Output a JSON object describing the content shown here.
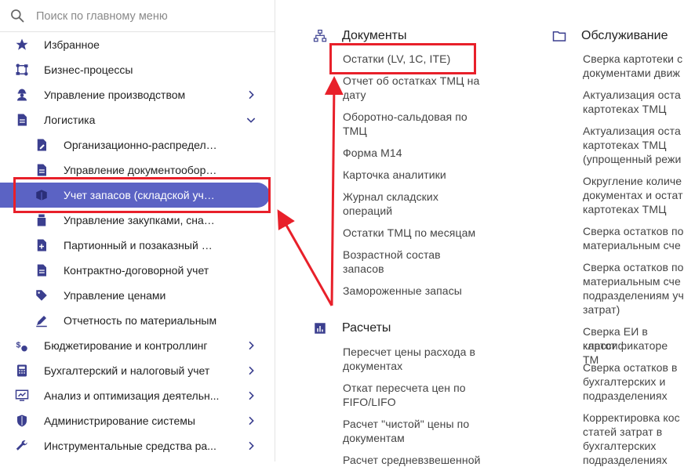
{
  "search": {
    "placeholder": "Поиск по главному меню"
  },
  "sidebar": {
    "items": [
      {
        "label": "Избранное"
      },
      {
        "label": "Бизнес-процессы"
      },
      {
        "label": "Управление производством"
      },
      {
        "label": "Логистика"
      },
      {
        "label": "Организационно-распределительн"
      },
      {
        "label": "Управление документооборотом"
      },
      {
        "label": "Учет запасов (складской учет)"
      },
      {
        "label": "Управление закупками, снабжением"
      },
      {
        "label": "Партионный и позаказный учет"
      },
      {
        "label": "Контрактно-договорной учет"
      },
      {
        "label": "Управление ценами"
      },
      {
        "label": "Отчетность по материальным"
      },
      {
        "label": "Бюджетирование и контроллинг"
      },
      {
        "label": "Бухгалтерский и налоговый учет"
      },
      {
        "label": "Анализ и оптимизация деятельн..."
      },
      {
        "label": "Администрирование системы"
      },
      {
        "label": "Инструментальные средства ра..."
      }
    ]
  },
  "main": {
    "documents": {
      "title": "Документы",
      "links": [
        "Остатки (LV, 1С, ITE)",
        "Отчет об остатках ТМЦ на",
        "дату",
        "Оборотно-сальдовая по",
        "ТМЦ",
        "Форма М14",
        "Карточка аналитики",
        "Журнал складских",
        "операций",
        "Остатки ТМЦ по месяцам",
        "Возрастной состав",
        "запасов",
        "Замороженные запасы"
      ]
    },
    "calculations": {
      "title": "Расчеты",
      "links": [
        "Пересчет цены расхода в",
        "документах",
        "Откат пересчета цен по",
        "FIFO/LIFO",
        "Расчет \"чистой\" цены по",
        "документам",
        "Расчет средневзвешенной"
      ]
    },
    "service": {
      "title": "Обслуживание",
      "links": [
        "Сверка картотеки с",
        "документами движ",
        "Актуализация оста",
        "картотеках ТМЦ",
        "Актуализация оста",
        "картотеках ТМЦ",
        "(упрощенный режи",
        "Округление количе",
        "документах и остат",
        "картотеках ТМЦ",
        "Сверка остатков по",
        "материальным сче",
        "Сверка остатков по",
        "материальным сче",
        "подразделениям уч",
        "затрат)",
        "Сверка ЕИ в картот",
        "классификаторе ТМ",
        "Сверка остатков в",
        "бухгалтерских и",
        "подразделениях",
        "Корректировка кос",
        "статей затрат в",
        "бухгалтерских",
        "подразделениях"
      ]
    }
  },
  "colors": {
    "accent": "#5b63c4",
    "annotation": "#e8202a",
    "icon": "#3b3f8f"
  }
}
